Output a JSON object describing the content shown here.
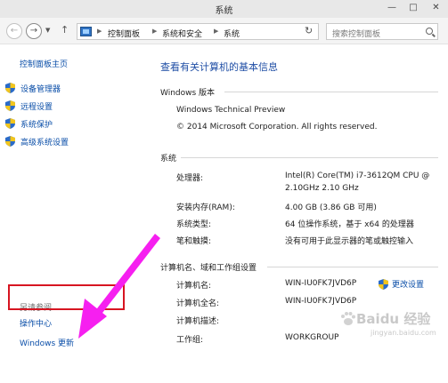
{
  "window": {
    "title": "系统",
    "minimize_glyph": "—",
    "maximize_glyph": "□",
    "close_glyph": "✕"
  },
  "nav": {
    "back_glyph": "←",
    "forward_glyph": "→",
    "up_glyph": "↑",
    "breadcrumb": [
      "控制面板",
      "系统和安全",
      "系统"
    ],
    "search_placeholder": "搜索控制面板"
  },
  "sidebar": {
    "home": "控制面板主页",
    "items": [
      {
        "label": "设备管理器",
        "icon": "shield-icon"
      },
      {
        "label": "远程设置",
        "icon": "shield-icon"
      },
      {
        "label": "系统保护",
        "icon": "shield-icon"
      },
      {
        "label": "高级系统设置",
        "icon": "shield-icon"
      }
    ],
    "see_also": "另请参阅",
    "links": [
      "操作中心",
      "Windows 更新"
    ]
  },
  "main": {
    "title": "查看有关计算机的基本信息",
    "edition": {
      "section": "Windows 版本",
      "name": "Windows Technical Preview",
      "copyright": "© 2014 Microsoft Corporation. All rights reserved."
    },
    "system": {
      "section": "系统",
      "rows": [
        {
          "label": "处理器:",
          "value": "Intel(R) Core(TM) i7-3612QM CPU @",
          "value2": "2.10GHz   2.10 GHz"
        },
        {
          "label": "安装内存(RAM):",
          "value": "4.00 GB (3.86 GB 可用)"
        },
        {
          "label": "系统类型:",
          "value": "64 位操作系统，基于 x64 的处理器"
        },
        {
          "label": "笔和触摸:",
          "value": "没有可用于此显示器的笔或触控输入"
        }
      ]
    },
    "computer": {
      "section": "计算机名、域和工作组设置",
      "rows": [
        {
          "label": "计算机名:",
          "value": "WIN-IU0FK7JVD6P"
        },
        {
          "label": "计算机全名:",
          "value": "WIN-IU0FK7JVD6P"
        },
        {
          "label": "计算机描述:",
          "value": ""
        },
        {
          "label": "工作组:",
          "value": "WORKGROUP"
        }
      ],
      "change_settings": "更改设置"
    }
  },
  "watermark": {
    "text": "Baidu 经验",
    "sub": "jingyan.baidu.com"
  },
  "colors": {
    "link": "#0a4ea8",
    "title": "#1f4ea5",
    "highlight": "#d71521",
    "arrow": "#f61ff0"
  }
}
